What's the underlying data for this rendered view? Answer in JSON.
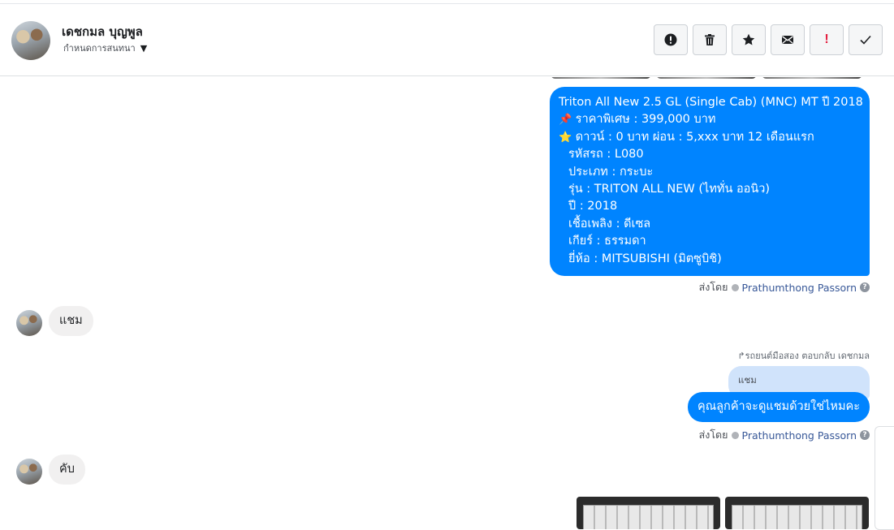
{
  "header": {
    "contact_name": "เดชกมล บุญพูล",
    "conversation_settings_label": "กำหนดการสนทนา",
    "actions": [
      {
        "name": "report-spam-button",
        "icon": "exclamation-circle-icon"
      },
      {
        "name": "delete-button",
        "icon": "trash-icon"
      },
      {
        "name": "star-button",
        "icon": "star-icon"
      },
      {
        "name": "mark-unread-button",
        "icon": "envelope-icon"
      },
      {
        "name": "mark-important-button",
        "icon": "exclamation-icon",
        "label": "!"
      },
      {
        "name": "mark-done-button",
        "icon": "check-icon"
      }
    ]
  },
  "thread": {
    "product_message": {
      "title": "Triton All New 2.5 GL (Single Cab) (MNC) MT ปี 2018",
      "price": "ราคาพิเศษ : 399,000 บาท",
      "down": "ดาวน์ : 0 บาท ผ่อน : 5,xxx บาท 12 เดือนแรก",
      "code": "รหัสรถ : L080",
      "type": "ประเภท : กระบะ",
      "model": "รุ่น : TRITON ALL NEW (ไททั่น ออนิว)",
      "year": "ปี : 2018",
      "fuel": "เชื้อเพลิง : ดีเซล",
      "gear": "เกียร์ : ธรรมดา",
      "brand": "ยี่ห้อ : MITSUBISHI (มิตซูบิชิ)",
      "pin_emoji": "📌",
      "star_emoji": "⭐"
    },
    "sent_by_label": "ส่งโดย",
    "sender_name": "Prathumthong Passorn",
    "incoming_1": "แชม",
    "reply_note": "รถยนต์มือสอง ตอบกลับ เดชกมล",
    "quoted_text": "แชม",
    "outgoing_reply": "คุณลูกค้าจะดูแชมด้วยใช่ไหมคะ",
    "incoming_2": "คับ"
  },
  "colors": {
    "outgoing_bubble": "#0084ff",
    "incoming_bubble": "#f1f0f0",
    "quoted_bubble": "#d0e3fb",
    "sender_link": "#385898"
  }
}
